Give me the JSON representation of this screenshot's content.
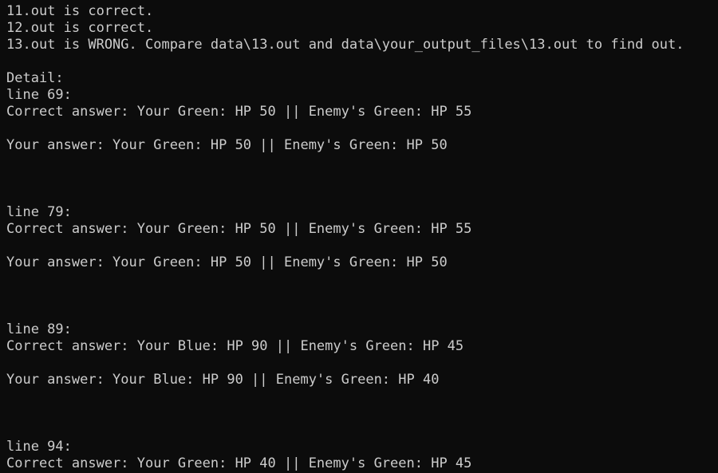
{
  "terminal": {
    "lines": [
      "11.out is correct.",
      "12.out is correct.",
      "13.out is WRONG. Compare data\\13.out and data\\your_output_files\\13.out to find out.",
      "",
      "Detail:",
      "line 69:",
      "Correct answer: Your Green: HP 50 || Enemy's Green: HP 55",
      "",
      "Your answer: Your Green: HP 50 || Enemy's Green: HP 50",
      "",
      "",
      "",
      "line 79:",
      "Correct answer: Your Green: HP 50 || Enemy's Green: HP 55",
      "",
      "Your answer: Your Green: HP 50 || Enemy's Green: HP 50",
      "",
      "",
      "",
      "line 89:",
      "Correct answer: Your Blue: HP 90 || Enemy's Green: HP 45",
      "",
      "Your answer: Your Blue: HP 90 || Enemy's Green: HP 40",
      "",
      "",
      "",
      "line 94:",
      "Correct answer: Your Green: HP 40 || Enemy's Green: HP 45"
    ]
  }
}
